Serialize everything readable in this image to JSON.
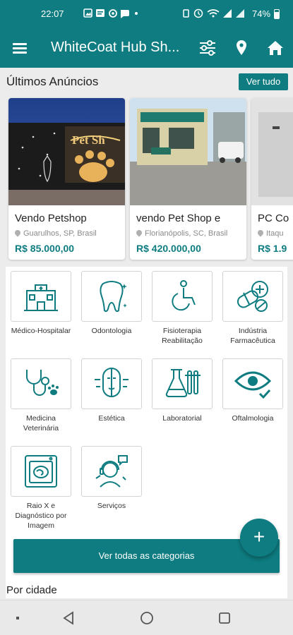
{
  "status_bar": {
    "time": "22:07",
    "notification_icons": [
      "gallery-icon",
      "message-icon",
      "settings-icon",
      "chat-icon",
      "dot-icon"
    ],
    "battery": "74%"
  },
  "app_bar": {
    "title": "WhiteCoat Hub Sh...",
    "actions": [
      "filter-icon",
      "location-pin-icon",
      "home-icon"
    ]
  },
  "latest_ads": {
    "title": "Últimos Anúncios",
    "see_all": "Ver tudo",
    "cards": [
      {
        "title": "Vendo Petshop",
        "location": "Guarulhos, SP, Brasil",
        "price": "R$ 85.000,00"
      },
      {
        "title": "vendo Pet Shop e",
        "location": "Florianópolis, SC, Brasil",
        "price": "R$ 420.000,00"
      },
      {
        "title": "PC Co",
        "location": "Itaqu",
        "price": "R$ 1.9"
      }
    ]
  },
  "categories": {
    "items": [
      {
        "label": "Médico-Hospitalar",
        "icon": "hospital-icon"
      },
      {
        "label": "Odontologia",
        "icon": "tooth-icon"
      },
      {
        "label": "Fisioterapia Reabilitação",
        "icon": "wheelchair-icon"
      },
      {
        "label": "Indústria Farmacêutica",
        "icon": "pills-icon"
      },
      {
        "label": "Medicina Veterinária",
        "icon": "stethoscope-paw-icon"
      },
      {
        "label": "Estética",
        "icon": "face-aesthetics-icon"
      },
      {
        "label": "Laboratorial",
        "icon": "lab-flask-icon"
      },
      {
        "label": "Oftalmologia",
        "icon": "eye-check-icon"
      },
      {
        "label": "Raio X e Diagnóstico por Imagem",
        "icon": "xray-icon"
      },
      {
        "label": "Serviços",
        "icon": "support-agent-icon"
      }
    ],
    "button": "Ver todas as categorias",
    "fab": "+"
  },
  "by_city": {
    "title": "Por cidade"
  },
  "colors": {
    "primary": "#0e7c80",
    "background": "#ececec"
  }
}
